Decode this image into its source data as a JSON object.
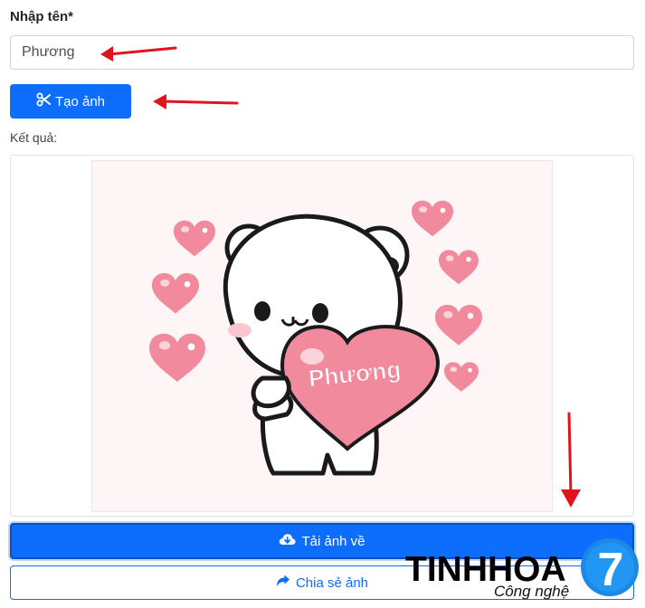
{
  "form": {
    "name_label": "Nhập tên*",
    "name_value": "Phương",
    "create_button": "Tạo ảnh",
    "result_label": "Kết quả:"
  },
  "result": {
    "image_text": "Phương"
  },
  "actions": {
    "download_button": "Tải ảnh về",
    "share_button": "Chia sẻ ảnh"
  },
  "watermark": {
    "brand": "TINHHOA",
    "tagline": "Công nghệ",
    "logo_digit": "7"
  },
  "colors": {
    "primary": "#0d6efd",
    "arrow": "#e0141e",
    "heart": "#f08a9c"
  },
  "icons": {
    "create": "scissors-icon",
    "download": "cloud-download-icon",
    "share": "share-arrow-icon"
  }
}
